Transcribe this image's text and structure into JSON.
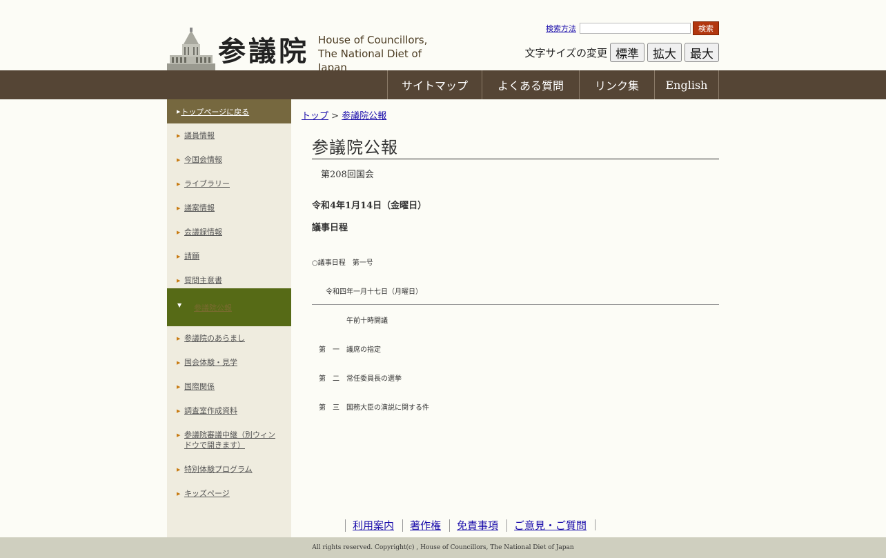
{
  "header": {
    "logo_kanji": "参議院",
    "logo_en_line1": "House of Councillors,",
    "logo_en_line2": "The National Diet of Japan",
    "search_help": "検索方法",
    "search_value": "",
    "search_button": "検索",
    "font_size_label": "文字サイズの変更",
    "font_sizes": [
      "標準",
      "拡大",
      "最大"
    ]
  },
  "nav": [
    "サイトマップ",
    "よくある質問",
    "リンク集",
    "English"
  ],
  "sidebar": {
    "top_link": "トップページに戻る",
    "items": [
      "議員情報",
      "今国会情報",
      "ライブラリー",
      "議案情報",
      "会議録情報",
      "請願",
      "質問主意書"
    ],
    "active": "参議院公報",
    "items_after": [
      "参議院のあらまし",
      "国会体験・見学",
      "国際関係",
      "調査室作成資料",
      "参議院審議中継（別ウィンドウで開きます）",
      "特別体験プログラム",
      "キッズページ"
    ]
  },
  "breadcrumb": {
    "home": "トップ",
    "separator": ">",
    "current": "参議院公報"
  },
  "main": {
    "title": "参議院公報",
    "session": "第208回国会",
    "date": "令和4年1月14日（金曜日）",
    "schedule_title": "議事日程",
    "agenda_lines": [
      "○議事日程　第一号",
      "　　令和四年一月十七日（月曜日）",
      "　　　　　午前十時開議",
      "　第　一　議席の指定",
      "　第　二　常任委員長の選挙",
      "　第　三　国務大臣の演説に関する件"
    ]
  },
  "footer": {
    "links": [
      "利用案内",
      "著作権",
      "免責事項",
      "ご意見・ご質問"
    ],
    "copyright": "All rights reserved. Copyright(c) , House of Councillors, The National Diet of Japan"
  }
}
